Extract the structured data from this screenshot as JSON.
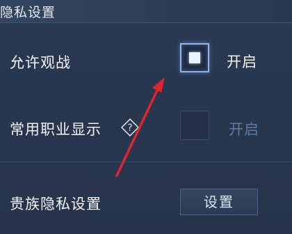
{
  "header": {
    "title": "隐私设置"
  },
  "rows": {
    "allow_spectate": {
      "label": "允许观战",
      "option_label": "开启",
      "checked": true
    },
    "common_role_display": {
      "label": "常用职业显示",
      "option_label": "开启",
      "checked": false,
      "help_icon": "question-diamond-icon"
    },
    "noble_privacy": {
      "label": "贵族隐私设置",
      "button_label": "设置"
    }
  },
  "annotation": {
    "icon": "red-arrow",
    "color": "#e0262a"
  }
}
